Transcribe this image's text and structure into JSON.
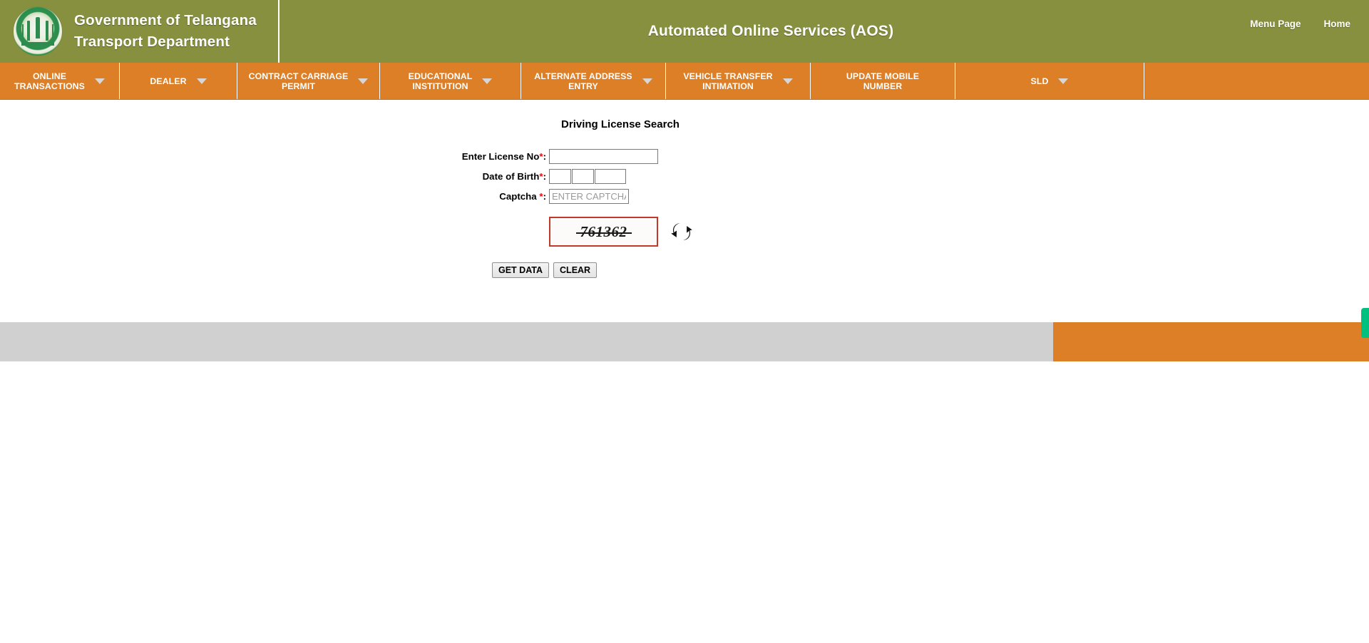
{
  "header": {
    "brand_line1": "Government of Telangana",
    "brand_line2": "Transport Department",
    "emblem_alt": "telangana-state-emblem",
    "title": "Automated Online Services (AOS)",
    "links": [
      {
        "label": "Menu Page"
      },
      {
        "label": "Home"
      }
    ]
  },
  "nav": {
    "items": [
      {
        "label": "ONLINE\nTRANSACTIONS",
        "has_caret": true
      },
      {
        "label": "DEALER",
        "has_caret": true
      },
      {
        "label": "CONTRACT CARRIAGE\nPERMIT",
        "has_caret": true
      },
      {
        "label": "EDUCATIONAL\nINSTITUTION",
        "has_caret": true
      },
      {
        "label": "ALTERNATE ADDRESS\nENTRY",
        "has_caret": true
      },
      {
        "label": "VEHICLE TRANSFER\nINTIMATION",
        "has_caret": true
      },
      {
        "label": "UPDATE MOBILE\nNUMBER",
        "has_caret": false
      },
      {
        "label": "SLD",
        "has_caret": true
      }
    ]
  },
  "main": {
    "page_title": "Driving License Search",
    "fields": {
      "license_label": "Enter License No",
      "license_value": "",
      "license_placeholder": "",
      "dob_label": "Date of Birth",
      "dob_day": "",
      "dob_month": "",
      "dob_year": "",
      "captcha_label": "Captcha ",
      "captcha_value": "",
      "captcha_placeholder": "ENTER CAPTCHA",
      "required_marker": "*",
      "colon": ":"
    },
    "captcha_image_text": "761362",
    "refresh_icon": "refresh-arrows-icon",
    "buttons": {
      "get_data": "GET DATA",
      "clear": "CLEAR"
    }
  },
  "colors": {
    "header_green": "#87903f",
    "nav_orange": "#dd7f27",
    "footer_gray": "#d0d0d0",
    "required_red": "#ff0000",
    "captcha_border_red": "#c0392b",
    "side_tab_green": "#00c07f"
  }
}
